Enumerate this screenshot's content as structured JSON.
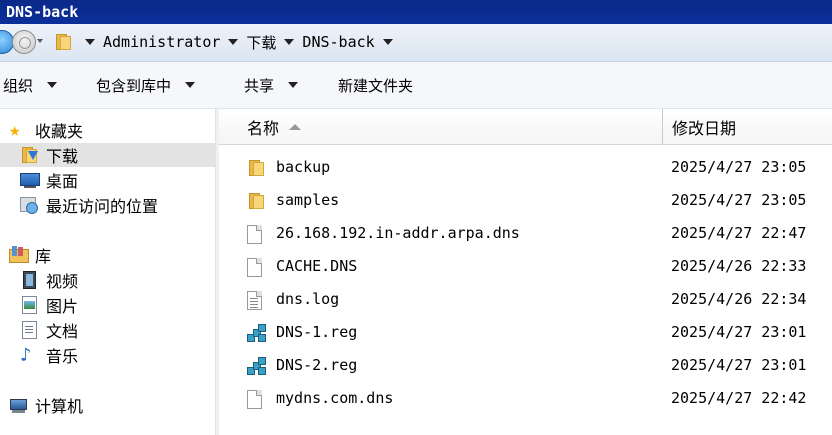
{
  "window": {
    "title": "DNS-back"
  },
  "address": {
    "crumbs": [
      "Administrator",
      "下载",
      "DNS-back"
    ]
  },
  "toolbar": {
    "organize": "组织",
    "include_library": "包含到库中",
    "share": "共享",
    "new_folder": "新建文件夹"
  },
  "nav": {
    "favorites": "收藏夹",
    "downloads": "下载",
    "desktop": "桌面",
    "recent": "最近访问的位置",
    "libraries": "库",
    "videos": "视频",
    "pictures": "图片",
    "documents": "文档",
    "music": "音乐",
    "computer": "计算机"
  },
  "columns": {
    "name": "名称",
    "date_modified": "修改日期"
  },
  "files": [
    {
      "name": "backup",
      "date": "2025/4/27 23:05",
      "icon": "folder-icon"
    },
    {
      "name": "samples",
      "date": "2025/4/27 23:05",
      "icon": "folder-icon"
    },
    {
      "name": "26.168.192.in-addr.arpa.dns",
      "date": "2025/4/27 22:47",
      "icon": "file-icon"
    },
    {
      "name": "CACHE.DNS",
      "date": "2025/4/26 22:33",
      "icon": "file-icon"
    },
    {
      "name": "dns.log",
      "date": "2025/4/26 22:34",
      "icon": "text-file-icon"
    },
    {
      "name": "DNS-1.reg",
      "date": "2025/4/27 23:01",
      "icon": "registry-file-icon"
    },
    {
      "name": "DNS-2.reg",
      "date": "2025/4/27 23:01",
      "icon": "registry-file-icon"
    },
    {
      "name": "mydns.com.dns",
      "date": "2025/4/27 22:42",
      "icon": "file-icon"
    }
  ],
  "colors": {
    "titlebar": "#0b2f9a",
    "selected_nav": "#e3e3e3"
  }
}
